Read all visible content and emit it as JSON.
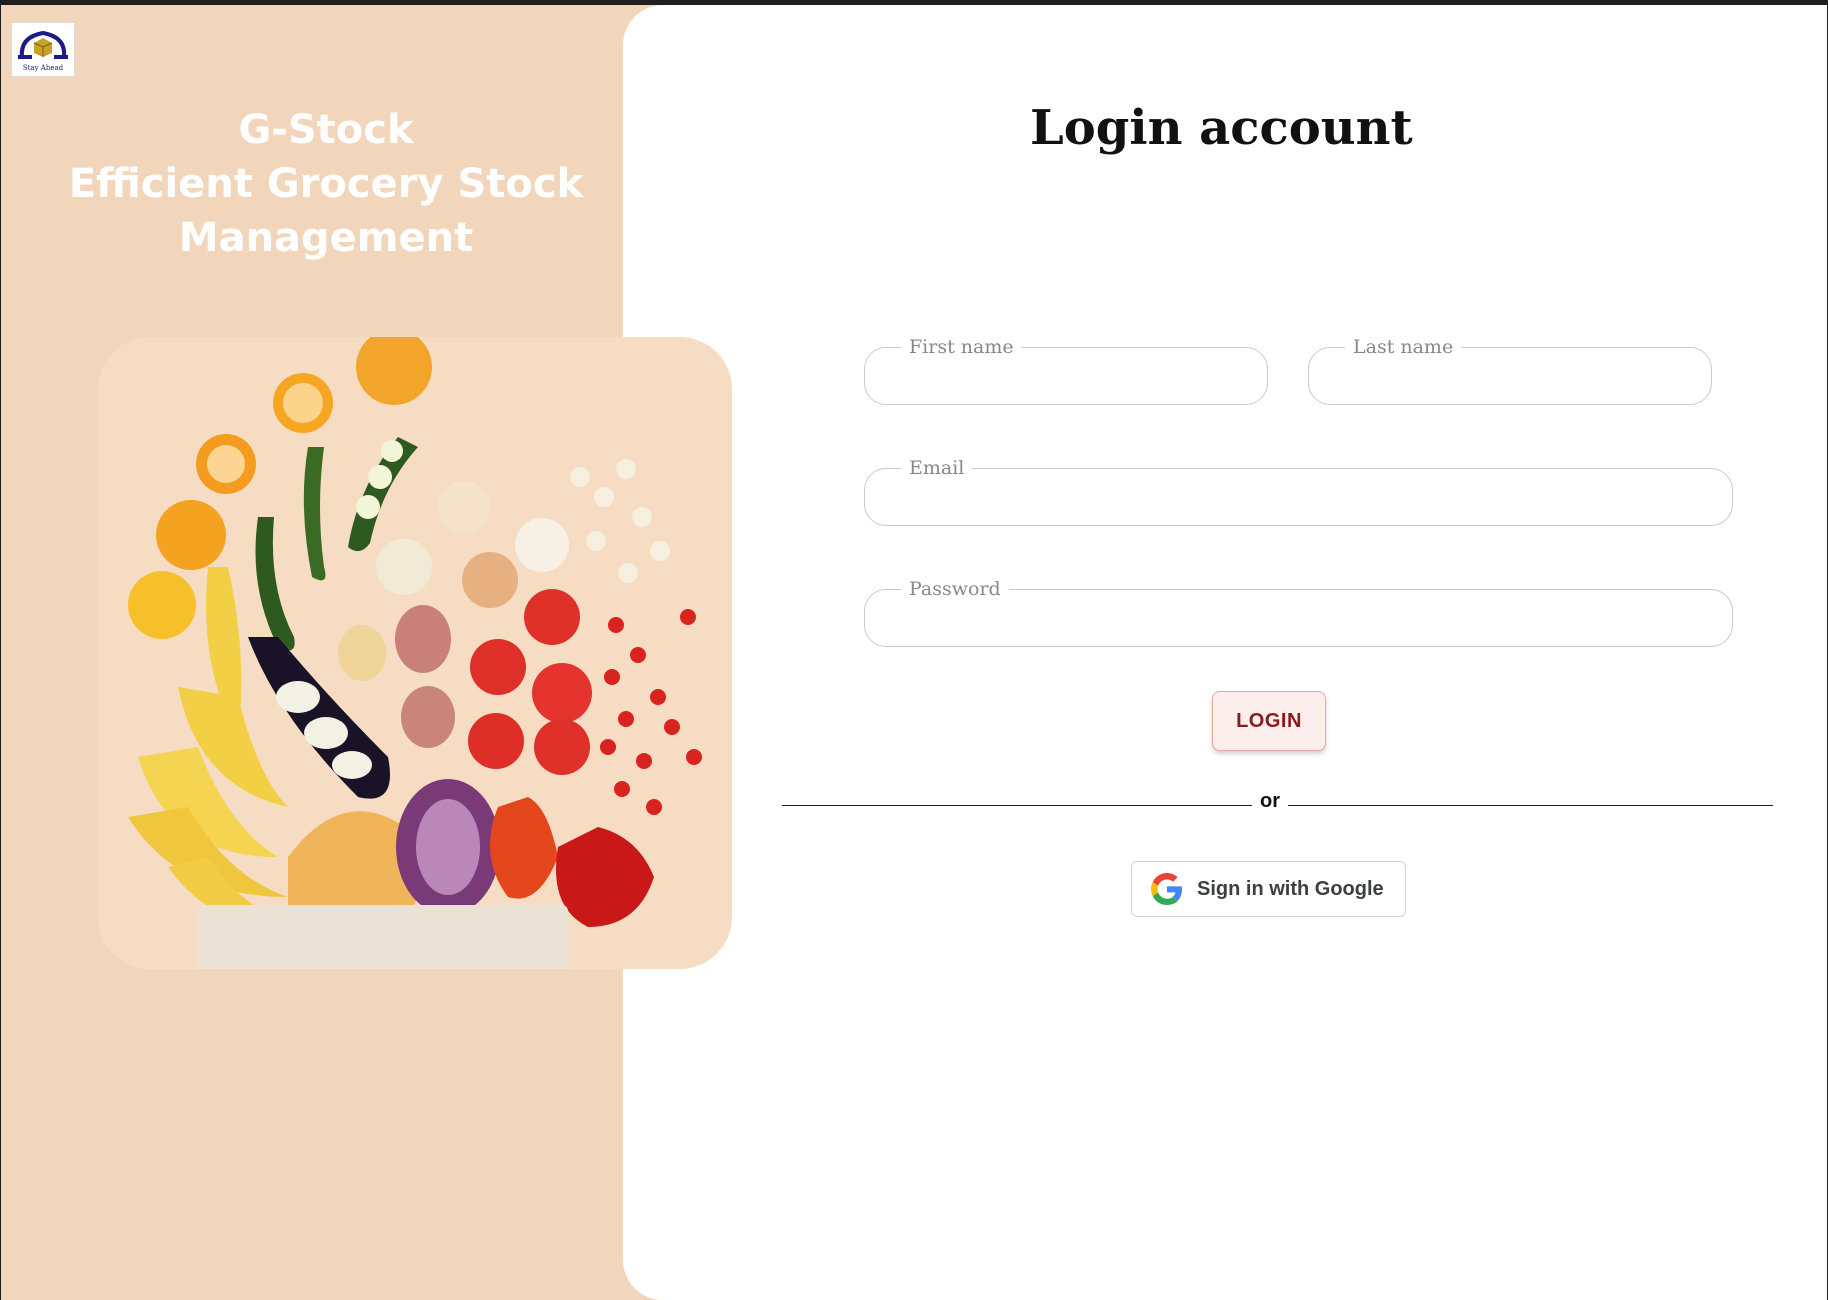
{
  "brand": {
    "logo_caption": "Stay Ahead",
    "lines": [
      "G-Stock",
      "Efficient Grocery Stock",
      "Management"
    ]
  },
  "login": {
    "title": "Login account",
    "fields": {
      "first_name": "First name",
      "last_name": "Last name",
      "email": "Email",
      "password": "Password"
    },
    "submit_label": "LOGIN",
    "divider_text": "or",
    "google_label": "Sign in with Google"
  },
  "icons": {
    "logo": "stay-ahead-logo-icon",
    "google": "google-g-icon"
  },
  "colors": {
    "panel_bg": "#f2d6bb",
    "login_text": "#8b1c1c",
    "login_bg": "#fbeeed"
  }
}
